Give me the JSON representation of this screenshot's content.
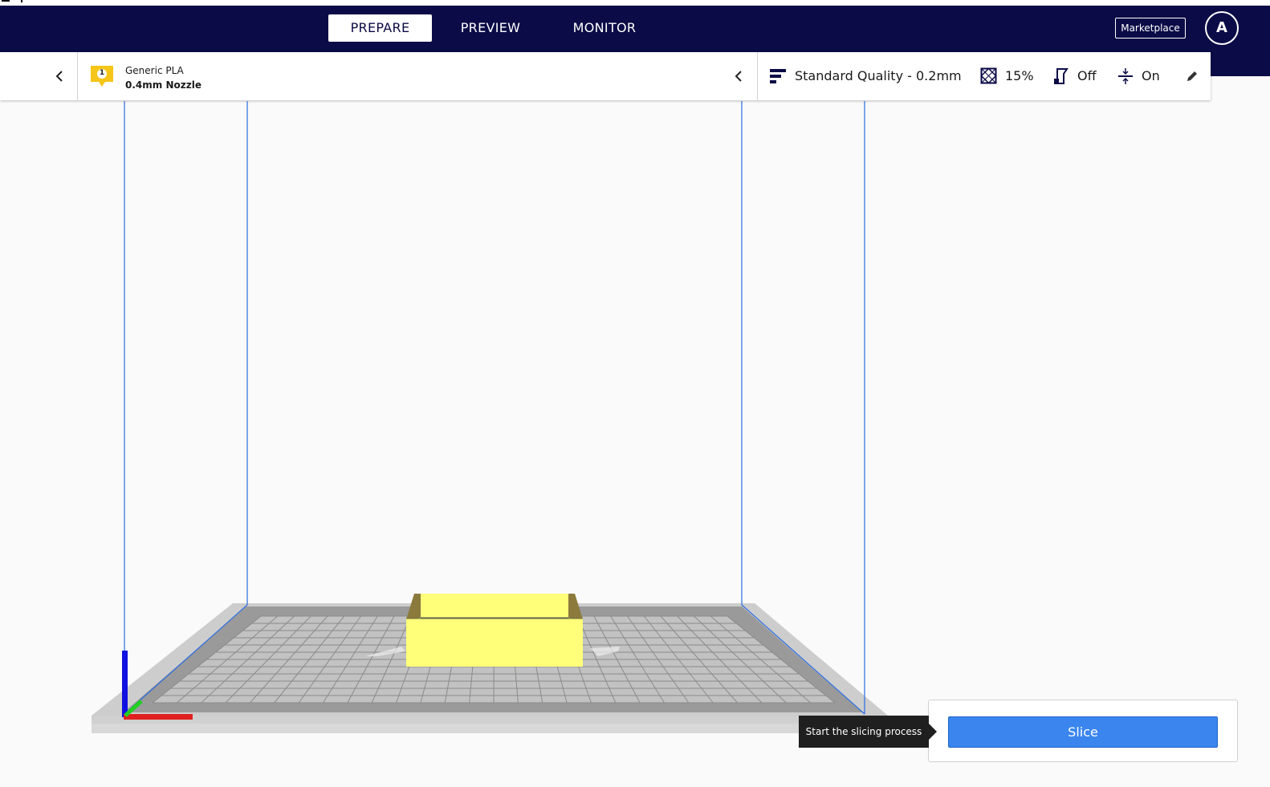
{
  "header": {
    "tabs": [
      {
        "label": "PREPARE",
        "active": true
      },
      {
        "label": "PREVIEW",
        "active": false
      },
      {
        "label": "MONITOR",
        "active": false
      }
    ],
    "marketplace_label": "Marketplace",
    "account_initial": "A"
  },
  "printer": {
    "extruder_number": "1",
    "material": "Generic PLA",
    "nozzle": "0.4mm Nozzle",
    "extruder_color": "#f5c518"
  },
  "print_settings": {
    "quality": "Standard Quality - 0.2mm",
    "infill": "15%",
    "support": "Off",
    "adhesion": "On"
  },
  "viewport": {
    "model_color": "#ffff7a",
    "build_volume_line_color": "#2a6be0",
    "axis_colors": {
      "x": "#e02020",
      "y": "#20d020",
      "z": "#1010e0"
    }
  },
  "action_panel": {
    "tooltip": "Start the slicing process",
    "slice_label": "Slice",
    "button_color": "#3a86ee"
  },
  "colors": {
    "header_bg": "#0b0b47"
  }
}
